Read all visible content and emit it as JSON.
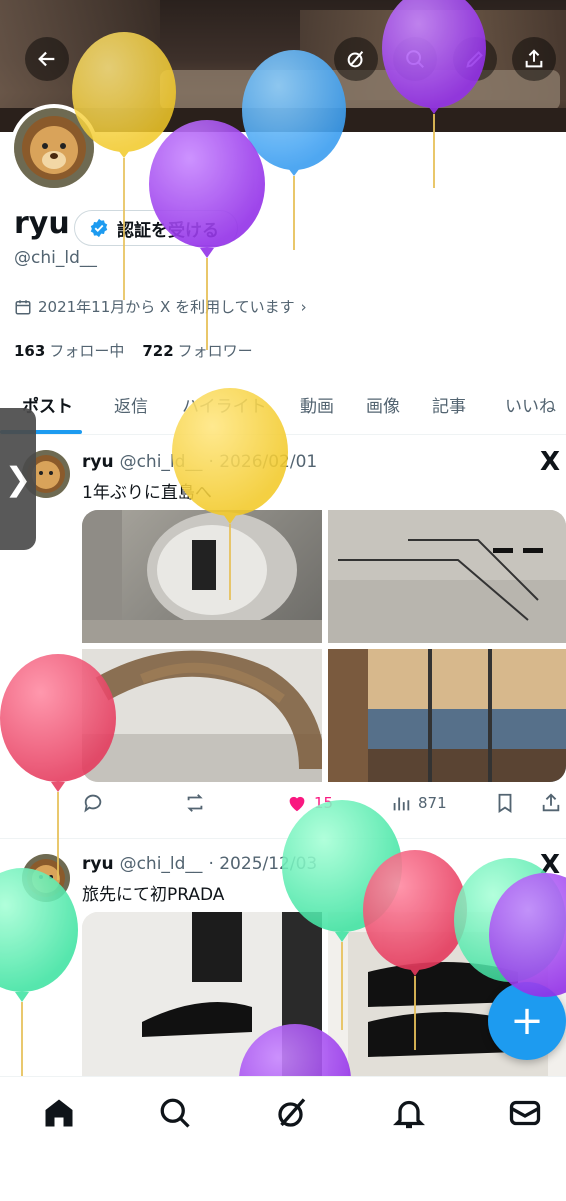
{
  "profile": {
    "name": "ryu",
    "verify_label": "認証を受ける",
    "handle": "@chi_ld__",
    "joined": "2021年11月から X を利用しています",
    "following_count": "163",
    "following_label": "フォロー中",
    "followers_count": "722",
    "followers_label": "フォロワー"
  },
  "tabs": [
    {
      "label": "ポスト",
      "active": true
    },
    {
      "label": "返信"
    },
    {
      "label": "ハイライト"
    },
    {
      "label": "動画"
    },
    {
      "label": "画像"
    },
    {
      "label": "記事"
    },
    {
      "label": "いいね"
    }
  ],
  "posts": [
    {
      "name": "ryu",
      "handle": "@chi_ld__",
      "date": "· 2026/02/01",
      "text": "1年ぶりに直島へ",
      "likes": "15",
      "views": "871"
    },
    {
      "name": "ryu",
      "handle": "@chi_ld__",
      "date": "· 2025/12/03",
      "text": "旅先にて初PRADA"
    }
  ],
  "icons": {
    "back": "back-arrow-icon",
    "grok": "grok-icon",
    "search": "search-icon",
    "edit": "pencil-icon",
    "share": "share-icon",
    "x_logo": "X"
  },
  "fab_label": "+",
  "side_handle": "❯",
  "colors": {
    "accent": "#1d9bf0",
    "like": "#f91880"
  }
}
